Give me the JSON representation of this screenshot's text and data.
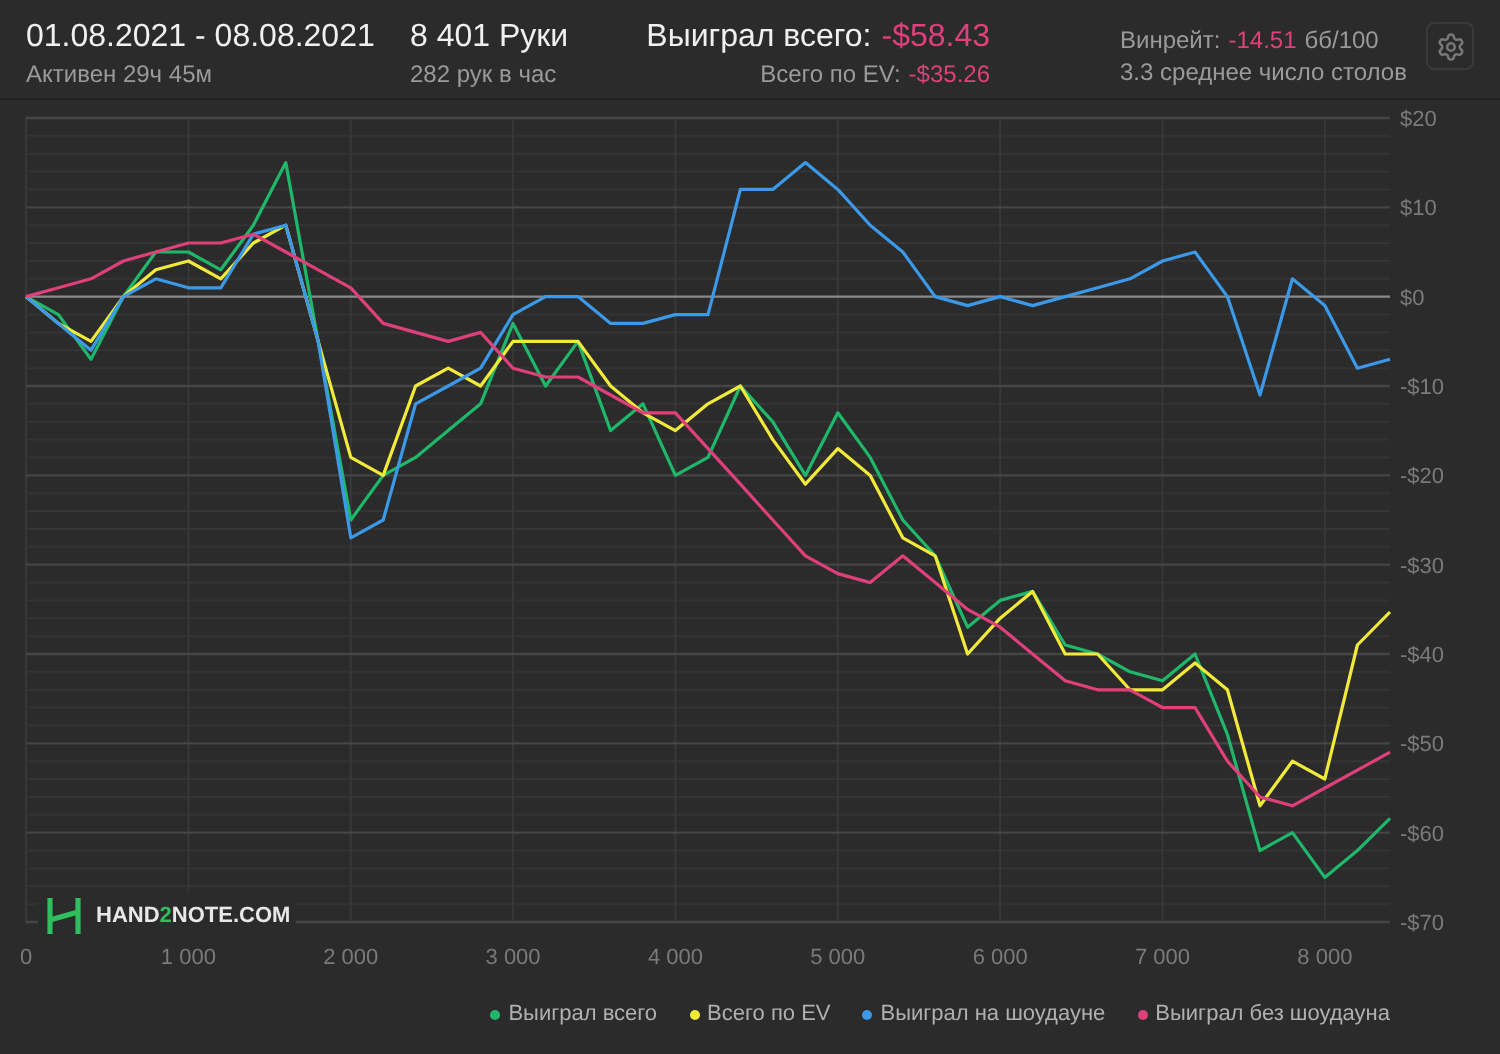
{
  "header": {
    "date_range": "01.08.2021 - 08.08.2021",
    "active": "Активен 29ч 45м",
    "hands": "8 401 Руки",
    "hands_per_hour": "282 рук в час",
    "won_label": "Выиграл всего:",
    "won_value": "-$58.43",
    "ev_label": "Всего по EV:",
    "ev_value": "-$35.26",
    "winrate_label": "Винрейт:",
    "winrate_value": "-14.51",
    "winrate_unit": "бб/100",
    "tables": "3.3 среднее число столов"
  },
  "chart": {
    "logo": {
      "parts": [
        "HAND",
        "2",
        "NOTE.COM"
      ]
    },
    "chart_data": {
      "type": "line",
      "grid": true,
      "x": [
        0,
        200,
        400,
        600,
        800,
        1000,
        1200,
        1400,
        1600,
        1800,
        2000,
        2200,
        2400,
        2600,
        2800,
        3000,
        3200,
        3400,
        3600,
        3800,
        4000,
        4200,
        4400,
        4600,
        4800,
        5000,
        5200,
        5400,
        5600,
        5800,
        6000,
        6200,
        6400,
        6600,
        6800,
        7000,
        7200,
        7400,
        7600,
        7800,
        8000,
        8200,
        8401
      ],
      "series": [
        {
          "name": "Выиграл всего",
          "color": "#1fb86a",
          "values": [
            0,
            -2,
            -7,
            0,
            5,
            5,
            3,
            8,
            15,
            -5,
            -25,
            -20,
            -18,
            -15,
            -12,
            -3,
            -10,
            -5,
            -15,
            -12,
            -20,
            -18,
            -10,
            -14,
            -20,
            -13,
            -18,
            -25,
            -29,
            -37,
            -34,
            -33,
            -39,
            -40,
            -42,
            -43,
            -40,
            -49,
            -62,
            -60,
            -65,
            -62,
            -58.4
          ]
        },
        {
          "name": "Всего по EV",
          "color": "#f2ea3a",
          "values": [
            0,
            -3,
            -5,
            0,
            3,
            4,
            2,
            6,
            8,
            -5,
            -18,
            -20,
            -10,
            -8,
            -10,
            -5,
            -5,
            -5,
            -10,
            -13,
            -15,
            -12,
            -10,
            -16,
            -21,
            -17,
            -20,
            -27,
            -29,
            -40,
            -36,
            -33,
            -40,
            -40,
            -44,
            -44,
            -41,
            -44,
            -57,
            -52,
            -54,
            -39,
            -35.3
          ]
        },
        {
          "name": "Выиграл на шоудауне",
          "color": "#3b99e8",
          "values": [
            0,
            -3,
            -6,
            0,
            2,
            1,
            1,
            7,
            8,
            -5,
            -27,
            -25,
            -12,
            -10,
            -8,
            -2,
            0,
            0,
            -3,
            -3,
            -2,
            -2,
            12,
            12,
            15,
            12,
            8,
            5,
            0,
            -1,
            0,
            -1,
            0,
            1,
            2,
            4,
            5,
            0,
            -11,
            2,
            -1,
            -8,
            -7
          ]
        },
        {
          "name": "Выиграл без шоудауна",
          "color": "#e0407a",
          "values": [
            0,
            1,
            2,
            4,
            5,
            6,
            6,
            7,
            5,
            3,
            1,
            -3,
            -4,
            -5,
            -4,
            -8,
            -9,
            -9,
            -11,
            -13,
            -13,
            -17,
            -21,
            -25,
            -29,
            -31,
            -32,
            -29,
            -32,
            -35,
            -37,
            -40,
            -43,
            -44,
            -44,
            -46,
            -46,
            -52,
            -56,
            -57,
            -55,
            -53,
            -51
          ]
        }
      ],
      "xlim": [
        0,
        8401
      ],
      "ylim": [
        -70,
        20
      ],
      "xticks": [
        {
          "value": 0,
          "label": "0"
        },
        {
          "value": 1000,
          "label": "1 000"
        },
        {
          "value": 2000,
          "label": "2 000"
        },
        {
          "value": 3000,
          "label": "3 000"
        },
        {
          "value": 4000,
          "label": "4 000"
        },
        {
          "value": 5000,
          "label": "5 000"
        },
        {
          "value": 6000,
          "label": "6 000"
        },
        {
          "value": 7000,
          "label": "7 000"
        },
        {
          "value": 8000,
          "label": "8 000"
        }
      ],
      "yticks": [
        {
          "value": 20,
          "label": "$20"
        },
        {
          "value": 10,
          "label": "$10"
        },
        {
          "value": 0,
          "label": "$0"
        },
        {
          "value": -10,
          "label": "-$10"
        },
        {
          "value": -20,
          "label": "-$20"
        },
        {
          "value": -30,
          "label": "-$30"
        },
        {
          "value": -40,
          "label": "-$40"
        },
        {
          "value": -50,
          "label": "-$50"
        },
        {
          "value": -60,
          "label": "-$60"
        },
        {
          "value": -70,
          "label": "-$70"
        }
      ]
    }
  }
}
